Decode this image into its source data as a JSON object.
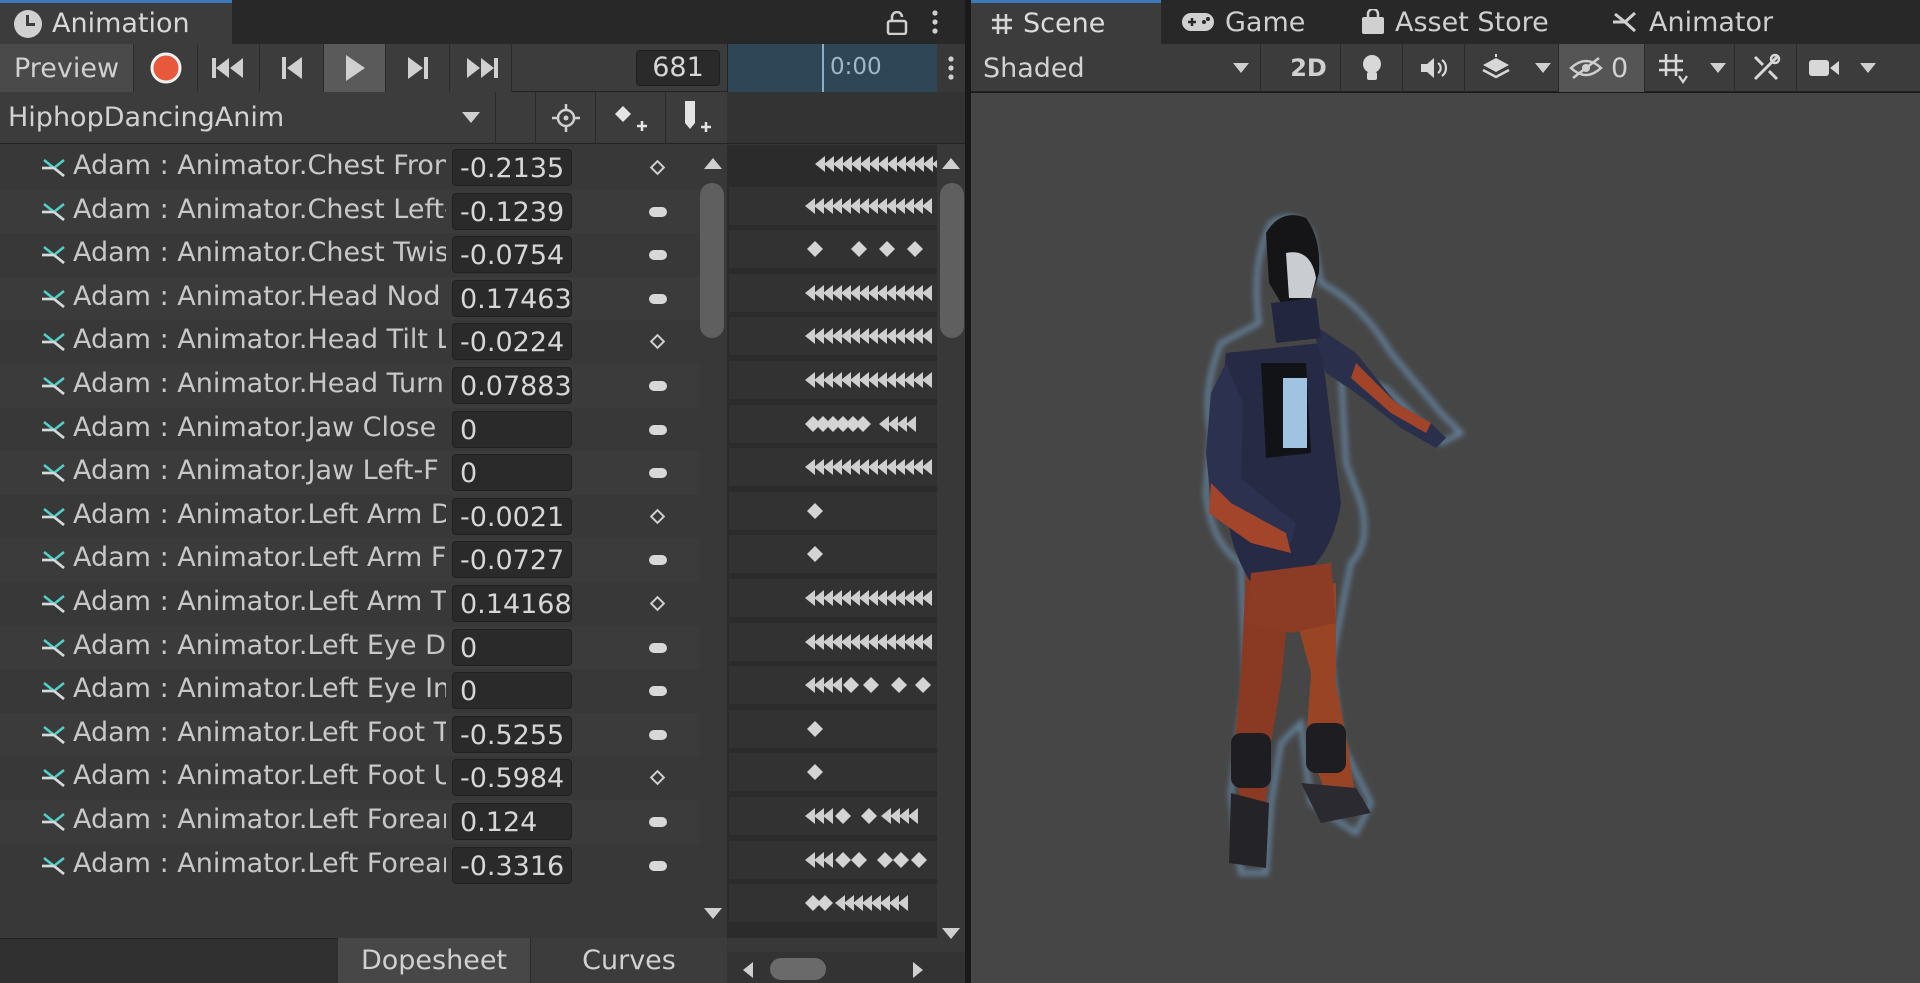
{
  "animation_window": {
    "tab_title": "Animation",
    "tab_icon": "clock-icon",
    "toolbar": {
      "preview_label": "Preview",
      "frame_value": "681",
      "timeline_time": "0:00"
    },
    "clip_name": "HiphopDancingAnim",
    "properties": [
      {
        "name": "Adam : Animator.Chest Fron",
        "value": "-0.2135",
        "key": "diamond"
      },
      {
        "name": "Adam : Animator.Chest Left-",
        "value": "-0.1239",
        "key": "pill"
      },
      {
        "name": "Adam : Animator.Chest Twis",
        "value": "-0.0754",
        "key": "pill"
      },
      {
        "name": "Adam : Animator.Head Nod",
        "value": "0.17463",
        "key": "pill"
      },
      {
        "name": "Adam : Animator.Head Tilt L",
        "value": "-0.0224",
        "key": "diamond"
      },
      {
        "name": "Adam : Animator.Head Turn",
        "value": "0.07883",
        "key": "pill"
      },
      {
        "name": "Adam : Animator.Jaw Close",
        "value": "0",
        "key": "pill"
      },
      {
        "name": "Adam : Animator.Jaw Left-F",
        "value": "0",
        "key": "pill"
      },
      {
        "name": "Adam : Animator.Left Arm Do",
        "value": "-0.0021",
        "key": "diamond"
      },
      {
        "name": "Adam : Animator.Left Arm Fr",
        "value": "-0.0727",
        "key": "pill"
      },
      {
        "name": "Adam : Animator.Left Arm Tv",
        "value": "0.14168",
        "key": "diamond"
      },
      {
        "name": "Adam : Animator.Left Eye Do",
        "value": "0",
        "key": "pill"
      },
      {
        "name": "Adam : Animator.Left Eye In",
        "value": "0",
        "key": "pill"
      },
      {
        "name": "Adam : Animator.Left Foot T",
        "value": "-0.5255",
        "key": "pill"
      },
      {
        "name": "Adam : Animator.Left Foot U",
        "value": "-0.5984",
        "key": "diamond"
      },
      {
        "name": "Adam : Animator.Left Forear",
        "value": "0.124",
        "key": "pill"
      },
      {
        "name": "Adam : Animator.Left Forear",
        "value": "-0.3316",
        "key": "pill"
      }
    ],
    "bottom_tabs": {
      "dopesheet": "Dopesheet",
      "curves": "Curves"
    }
  },
  "scene_window": {
    "tabs": [
      {
        "label": "Scene",
        "icon": "hash-icon",
        "active": true
      },
      {
        "label": "Game",
        "icon": "gamepad-icon",
        "active": false
      },
      {
        "label": "Asset Store",
        "icon": "shopping-bag-icon",
        "active": false
      },
      {
        "label": "Animator",
        "icon": "animator-icon",
        "active": false
      }
    ],
    "toolbar": {
      "draw_mode": "Shaded",
      "mode_2d": "2D",
      "hidden_count": "0"
    }
  },
  "colors": {
    "accent_blue": "#3a79bb",
    "record_red": "#e8583a",
    "curve_icon_teal": "#4fd1c8",
    "timeline_blue": "#2f4656"
  }
}
